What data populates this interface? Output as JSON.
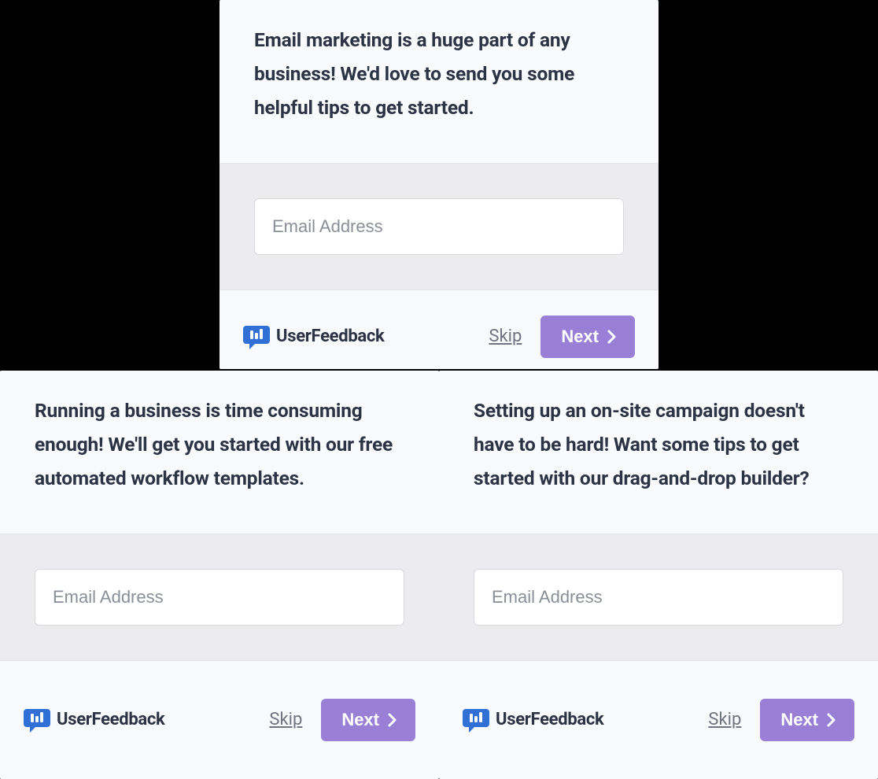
{
  "brandName": "UserFeedback",
  "emailPlaceholder": "Email Address",
  "skipLabel": "Skip",
  "nextLabel": "Next",
  "cards": {
    "top": {
      "heading": "Email marketing is a huge part of any business! We'd love to send you some helpful tips to get started."
    },
    "left": {
      "heading": "Running a business is time consuming enough! We'll get you started with our free automated workflow templates."
    },
    "right": {
      "heading": "Setting up an on-site campaign doesn't have to be hard! Want some tips to get started with our drag-and-drop builder?"
    }
  },
  "colors": {
    "accent": "#9a7fd6",
    "brand": "#2f6fd6",
    "textDark": "#2c3345",
    "muted": "#6f7480"
  }
}
